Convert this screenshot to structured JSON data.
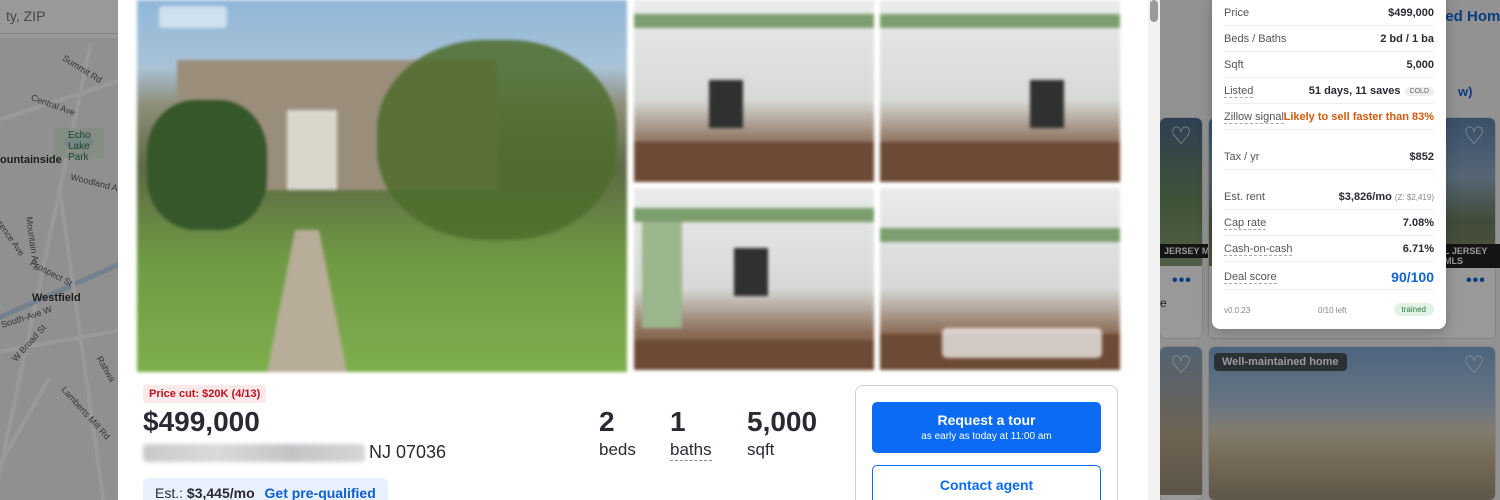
{
  "background": {
    "search_placeholder": "ty, ZIP",
    "saved_homes_label": "ved Hom",
    "sort_label": "w)",
    "map_labels": {
      "summit_rd": "Summit Rd",
      "central_ave": "Central Ave",
      "echo_lake_park": "Echo Lake Park",
      "mountainside": "ountainside",
      "woodland": "Woodland Av",
      "mountain_ave": "Mountain Ave",
      "lawrence_ave": "wrence Ave",
      "prospect_st": "Prospect St",
      "westfield": "Westfield",
      "south_ave_w": "South-Ave W",
      "w_broad_st": "W Broad St",
      "rahway": "Rahwa",
      "lamberts_mill": "Lamberts Mill Rd"
    },
    "cards": {
      "mls_label": "L JERSEY MLS",
      "mls_label_short": "JERSEY MLS",
      "badge_label": "Well-maintained home",
      "more_glyph": "•••",
      "heart_glyph": "♡",
      "card_e_char": "e"
    }
  },
  "listing": {
    "price_cut": "Price cut: $20K (4/13)",
    "price": "$499,000",
    "address_visible": "NJ 07036",
    "est_label": "Est.:",
    "est_value": "$3,445/mo",
    "prequal_label": "Get pre-qualified",
    "stats": {
      "beds_num": "2",
      "beds_unit": "beds",
      "baths_num": "1",
      "baths_unit": "baths",
      "sqft_num": "5,000",
      "sqft_unit": "sqft"
    },
    "tour_title": "Request a tour",
    "tour_subtitle": "as early as today at 11:00 am",
    "contact_label": "Contact agent"
  },
  "panel": {
    "rows": {
      "price": {
        "label": "Price",
        "value": "$499,000"
      },
      "beds_baths": {
        "label": "Beds / Baths",
        "value": "2 bd / 1 ba"
      },
      "sqft": {
        "label": "Sqft",
        "value": "5,000"
      },
      "listed": {
        "label": "Listed",
        "value": "51 days, 11 saves",
        "tag": "COLD"
      },
      "zillow_signal": {
        "label": "Zillow signal",
        "value": "Likely to sell faster than 83%"
      },
      "tax": {
        "label": "Tax / yr",
        "value": "$852"
      },
      "est_rent": {
        "label": "Est. rent",
        "value": "$3,826/mo",
        "sub": "(Z: $2,419)"
      },
      "cap_rate": {
        "label": "Cap rate",
        "value": "7.08%"
      },
      "cash_on_cash": {
        "label": "Cash-on-cash",
        "value": "6.71%"
      },
      "deal_score": {
        "label": "Deal score",
        "value": "90/100"
      }
    },
    "footer": {
      "version": "v0.0.23",
      "left": "0/10 left",
      "status": "trained"
    }
  },
  "colors": {
    "accent_blue": "#0b6cf3",
    "signal_orange": "#d35a0d",
    "price_cut_red": "#c0111f",
    "trained_green": "#2d7a3e"
  }
}
